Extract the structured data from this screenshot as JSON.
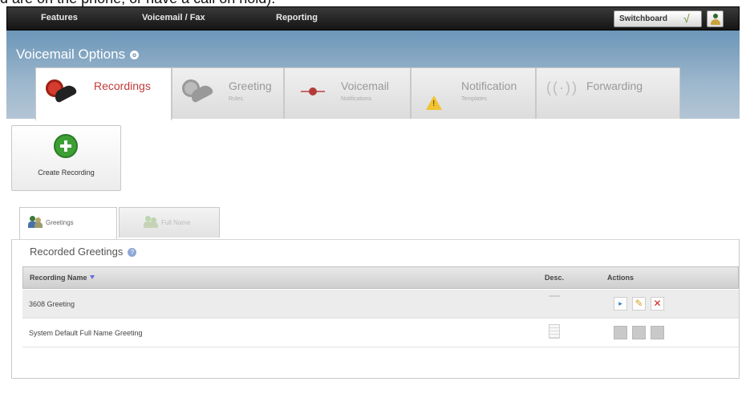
{
  "top_clip_text": "d are on the phone, or have a call on hold).",
  "topnav": {
    "features": "Features",
    "voicemail_fax": "Voicemail / Fax",
    "reporting": "Reporting",
    "switchboard": "Switchboard",
    "switchboard_check": "√"
  },
  "header": {
    "title": "Voicemail Options",
    "help_glyph": "o"
  },
  "tabs": [
    {
      "label": "Recordings",
      "sub": ""
    },
    {
      "label": "Greeting",
      "sub": "Rules"
    },
    {
      "label": "Voicemail",
      "sub": "Notifications"
    },
    {
      "label": "Notification",
      "sub": "Templates"
    },
    {
      "label": "Forwarding",
      "sub": ""
    }
  ],
  "create_button": {
    "label": "Create Recording"
  },
  "subtabs": [
    {
      "label": "Greetings"
    },
    {
      "label": "Full Name"
    }
  ],
  "section": {
    "title": "Recorded Greetings",
    "help_glyph": "?"
  },
  "table": {
    "columns": [
      "Recording Name",
      "Desc.",
      "Actions"
    ],
    "rows": [
      {
        "name": "3608 Greeting",
        "actions_enabled": true
      },
      {
        "name": "System Default Full Name Greeting",
        "actions_enabled": false
      }
    ]
  },
  "icons": {
    "play": "▸",
    "edit": "✎",
    "delete": "✕"
  }
}
